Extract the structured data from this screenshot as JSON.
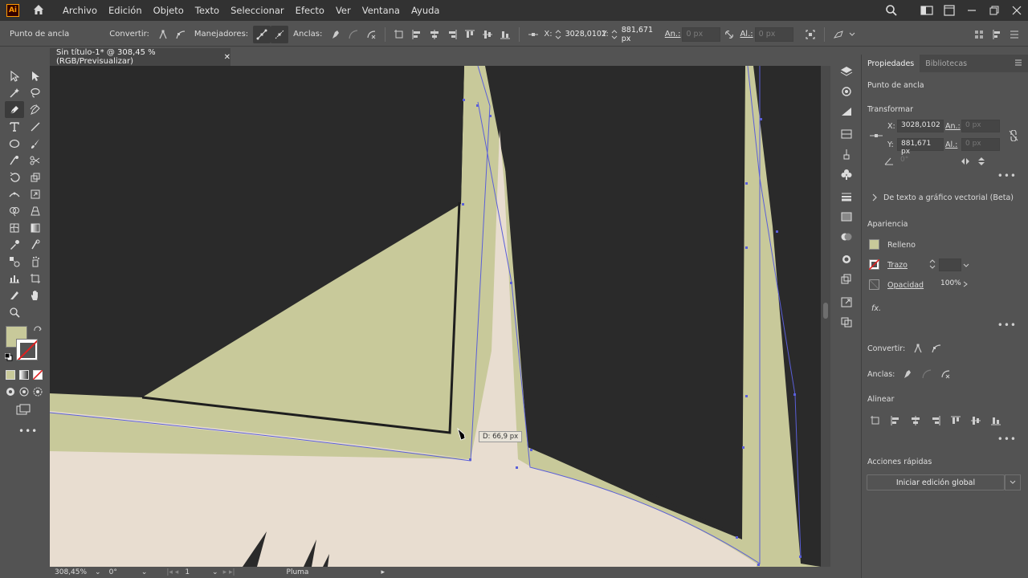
{
  "app": {
    "logo": "Ai"
  },
  "menu": [
    "Archivo",
    "Edición",
    "Objeto",
    "Texto",
    "Seleccionar",
    "Efecto",
    "Ver",
    "Ventana",
    "Ayuda"
  ],
  "control": {
    "tool_label": "Punto de ancla",
    "convert_label": "Convertir:",
    "handles_label": "Manejadores:",
    "anchors_label": "Anclas:",
    "x_label": "X:",
    "x_value": "3028,0102",
    "y_label": "Y:",
    "y_value": "881,671 px",
    "w_label": "An.:",
    "w_value": "0 px",
    "h_label": "Al.:",
    "h_value": "0 px"
  },
  "document": {
    "tab_title": "Sin título-1* @ 308,45 % (RGB/Previsualizar)",
    "measure_tooltip": "D: 66,9 px"
  },
  "status": {
    "zoom": "308,45%",
    "rotation": "0°",
    "artboard": "1",
    "tool": "Pluma"
  },
  "panel": {
    "tabs": [
      "Propiedades",
      "Bibliotecas"
    ],
    "selection_type": "Punto de ancla",
    "transform_title": "Transformar",
    "x_label": "X:",
    "x_value": "3028,0102",
    "y_label": "Y:",
    "y_value": "881,671 px",
    "w_label": "An.:",
    "w_value": "0 px",
    "h_label": "Al.:",
    "h_value": "0 px",
    "angle_value": "0°",
    "text_to_vector": "De texto a gráfico vectorial (Beta)",
    "appearance_title": "Apariencia",
    "fill_label": "Relleno",
    "stroke_label": "Trazo",
    "opacity_label": "Opacidad",
    "opacity_value": "100%",
    "fx_label": "fx.",
    "convert_label": "Convertir:",
    "anchors_label": "Anclas:",
    "align_title": "Alinear",
    "quick_actions_title": "Acciones rápidas",
    "global_edit_button": "Iniciar edición global"
  },
  "colors": {
    "fill": "#c8c99a",
    "canvas_dark": "#2a2a2a",
    "shape_cream": "#e8ddd0",
    "path_blue": "#5a5fd8",
    "accent": "#ff9a00"
  }
}
